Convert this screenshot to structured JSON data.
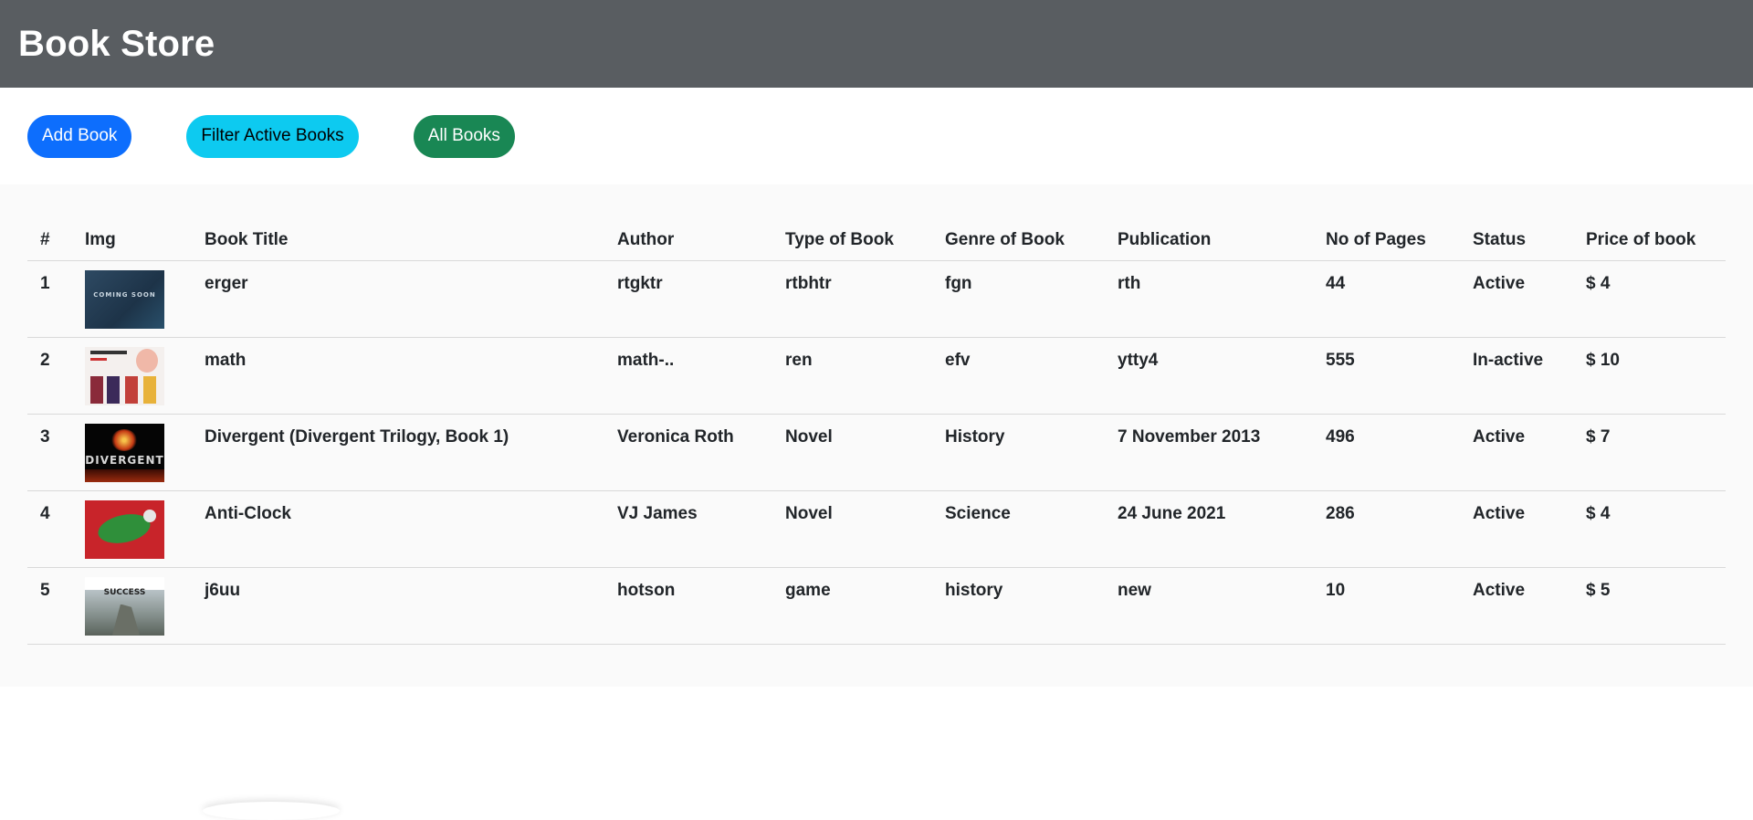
{
  "app": {
    "title": "Book Store"
  },
  "toolbar": {
    "add_label": "Add Book",
    "filter_label": "Filter Active Books",
    "all_label": "All Books",
    "colors": {
      "add": "#0d6efd",
      "filter": "#0dcaf0",
      "all": "#198754"
    }
  },
  "table": {
    "headers": [
      "#",
      "Img",
      "Book Title",
      "Author",
      "Type of Book",
      "Genre of Book",
      "Publication",
      "No of Pages",
      "Status",
      "Price of book"
    ],
    "rows": [
      {
        "num": "1",
        "image_thumb": "coming-soon-thumb",
        "image_text": "COMING SOON",
        "title": "erger",
        "author": "rtgktr",
        "type": "rtbhtr",
        "genre": "fgn",
        "publication": "rth",
        "pages": "44",
        "status": "Active",
        "price": "$ 4"
      },
      {
        "num": "2",
        "image_thumb": "books-collage-thumb",
        "title": "math",
        "author": "math-..",
        "type": "ren",
        "genre": "efv",
        "publication": "ytty4",
        "pages": "555",
        "status": "In-active",
        "price": "$ 10"
      },
      {
        "num": "3",
        "image_thumb": "divergent-cover-thumb",
        "image_text": "DIVERGENT",
        "title": "Divergent (Divergent Trilogy, Book 1)",
        "author": "Veronica Roth",
        "type": "Novel",
        "genre": "History",
        "publication": "7 November 2013",
        "pages": "496",
        "status": "Active",
        "price": "$ 7"
      },
      {
        "num": "4",
        "image_thumb": "anti-clock-cover-thumb",
        "title": "Anti-Clock",
        "author": "VJ James",
        "type": "Novel",
        "genre": "Science",
        "publication": "24 June 2021",
        "pages": "286",
        "status": "Active",
        "price": "$ 4"
      },
      {
        "num": "5",
        "image_thumb": "success-cover-thumb",
        "image_text": "SUCCESS",
        "title": "j6uu",
        "author": "hotson",
        "type": "game",
        "genre": "history",
        "publication": "new",
        "pages": "10",
        "status": "Active",
        "price": "$ 5"
      }
    ]
  }
}
